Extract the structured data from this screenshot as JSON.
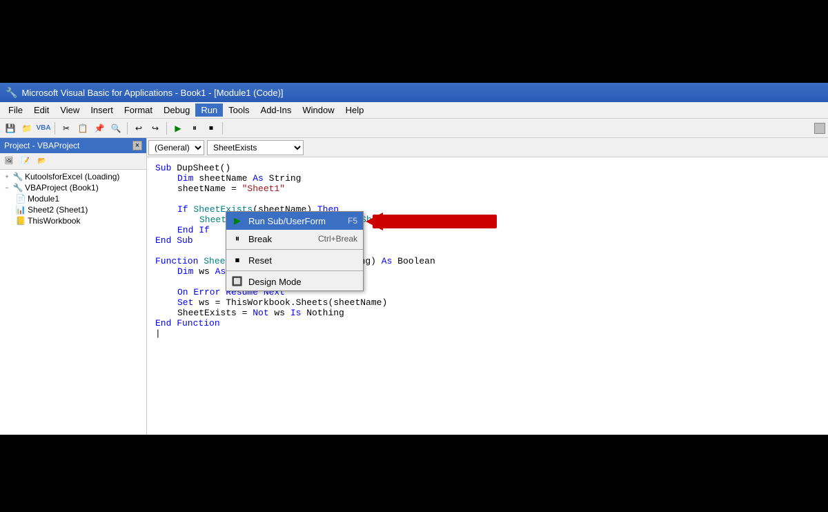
{
  "window": {
    "title": "Microsoft Visual Basic for Applications - Book1 - [Module1 (Code)]",
    "icon": "vba-icon"
  },
  "menubar": {
    "items": [
      "File",
      "Edit",
      "View",
      "Insert",
      "Format",
      "Debug",
      "Run",
      "Tools",
      "Add-Ins",
      "Window",
      "Help"
    ]
  },
  "project_panel": {
    "title": "Project - VBAProject",
    "close_label": "×",
    "tree": [
      {
        "label": "KutoolsforExcel (Loading)",
        "indent": 0,
        "type": "project"
      },
      {
        "label": "VBAProject (Book1)",
        "indent": 0,
        "type": "project"
      },
      {
        "label": "Module1",
        "indent": 1,
        "type": "module"
      },
      {
        "label": "Sheet2 (Sheet1)",
        "indent": 1,
        "type": "sheet"
      },
      {
        "label": "ThisWorkbook",
        "indent": 1,
        "type": "workbook"
      }
    ]
  },
  "code_editor": {
    "general_dropdown": "(General)",
    "function_dropdown": "SheetExists",
    "code_lines": [
      "Sub DupSheet()",
      "    Dim sheetName As String",
      "    sheetName = \"Sheet1\"",
      "",
      "    If SheetExists(sheetName) Then",
      "        Sheets(sheetName).Copy after:=Sheets(Sheets.Count)",
      "    End If",
      "End Sub",
      "",
      "Function SheetExists(sheetName As String) As Boolean",
      "    Dim ws As Worksheet",
      "",
      "    On Error Resume Next",
      "    Set ws = ThisWorkbook.Sheets(sheetName)",
      "    SheetExists = Not ws Is Nothing",
      "End Function"
    ]
  },
  "run_menu": {
    "is_open": true,
    "items": [
      {
        "label": "Run Sub/UserForm",
        "shortcut": "F5",
        "icon": "run-icon",
        "highlighted": true
      },
      {
        "label": "Break",
        "shortcut": "Ctrl+Break",
        "icon": "break-icon",
        "highlighted": false
      },
      {
        "label": "Reset",
        "shortcut": "",
        "icon": "reset-icon",
        "highlighted": false
      },
      {
        "label": "Design Mode",
        "shortcut": "",
        "icon": "design-icon",
        "highlighted": false
      }
    ]
  },
  "arrow": {
    "color": "#cc0000",
    "pointing_to": "Run Sub/UserForm"
  }
}
